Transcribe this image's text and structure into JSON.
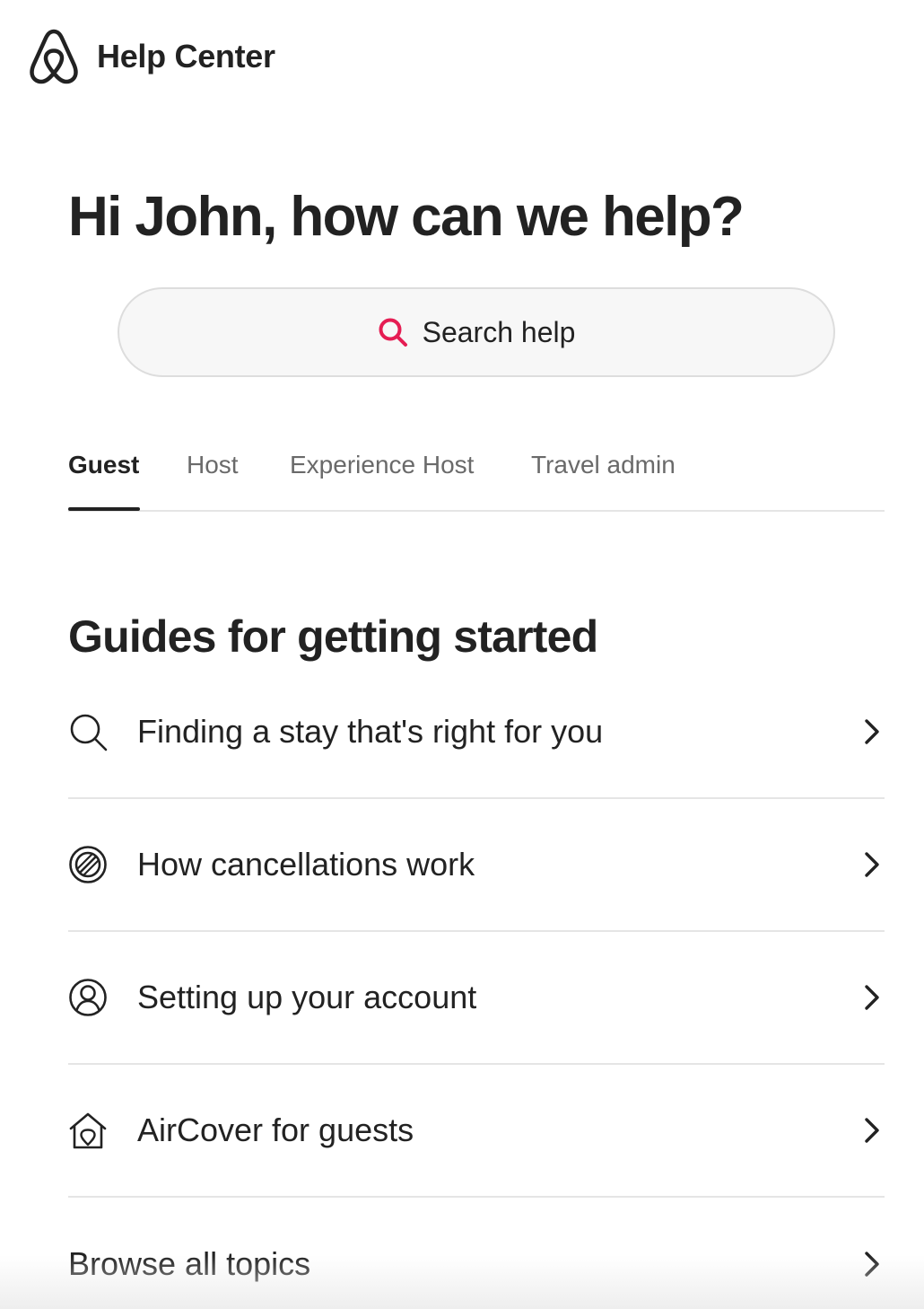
{
  "header": {
    "logo_icon": "airbnb-logo-icon",
    "title": "Help Center"
  },
  "hero": {
    "greeting": "Hi John, how can we help?"
  },
  "search": {
    "icon": "search-icon",
    "icon_color": "#E51D53",
    "label": "Search help"
  },
  "tabs": [
    {
      "label": "Guest",
      "active": true
    },
    {
      "label": "Host",
      "active": false
    },
    {
      "label": "Experience Host",
      "active": false
    },
    {
      "label": "Travel admin",
      "active": false
    }
  ],
  "guides": {
    "title": "Guides for getting started",
    "items": [
      {
        "icon": "search-icon",
        "label": "Finding a stay that's right for you"
      },
      {
        "icon": "cancel-icon",
        "label": "How cancellations work"
      },
      {
        "icon": "account-icon",
        "label": "Setting up your account"
      },
      {
        "icon": "aircover-home-icon",
        "label": "AirCover for guests"
      },
      {
        "icon": "",
        "label": "Browse all topics"
      }
    ]
  }
}
